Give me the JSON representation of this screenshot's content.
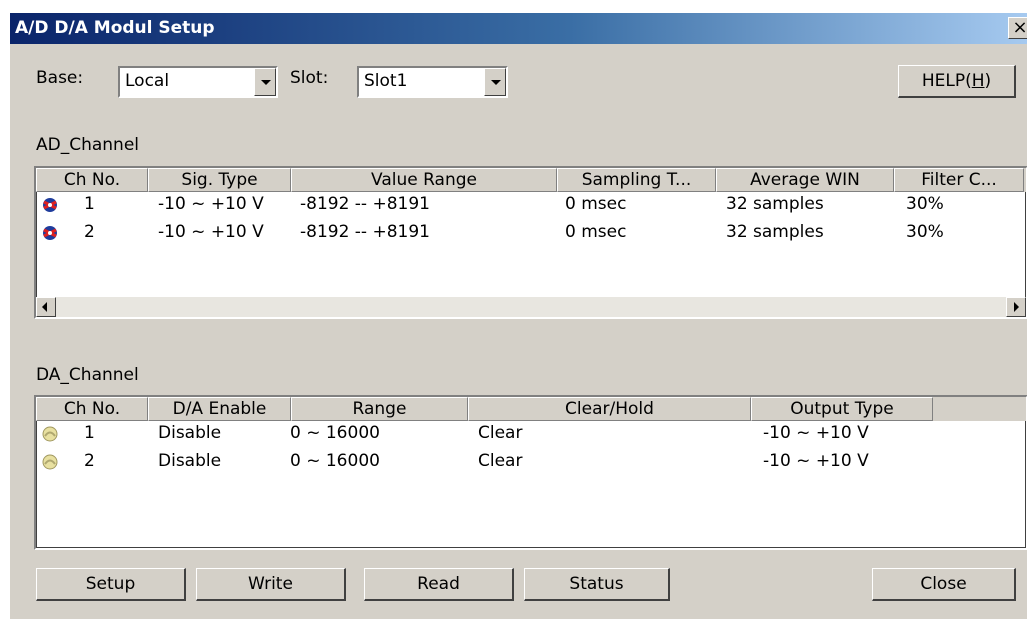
{
  "window": {
    "title": "A/D D/A Modul Setup",
    "close_glyph": "×"
  },
  "top": {
    "base_label": "Base:",
    "base_value": "Local",
    "slot_label": "Slot:",
    "slot_value": "Slot1",
    "help_label": "HELP(",
    "help_mnemonic": "H",
    "help_suffix": ")"
  },
  "ad": {
    "group_label": "AD_Channel",
    "columns": [
      "Ch No.",
      "Sig. Type",
      "Value Range",
      "Sampling T...",
      "Average WIN",
      "Filter C..."
    ],
    "rows": [
      {
        "icon": "ad-channel-icon",
        "ch": "1",
        "sig": "-10 ~ +10 V",
        "range": "-8192 -- +8191",
        "sampling": "0 msec",
        "average": "32 samples",
        "filter": "30%"
      },
      {
        "icon": "ad-channel-icon",
        "ch": "2",
        "sig": "-10 ~ +10 V",
        "range": "-8192 -- +8191",
        "sampling": "0 msec",
        "average": "32 samples",
        "filter": "30%"
      }
    ]
  },
  "da": {
    "group_label": "DA_Channel",
    "columns": [
      "Ch No.",
      "D/A Enable",
      "Range",
      "Clear/Hold",
      "Output Type"
    ],
    "rows": [
      {
        "icon": "da-channel-icon",
        "ch": "1",
        "enable": "Disable",
        "range": "0 ~ 16000",
        "clear": "Clear",
        "output": "-10 ~ +10 V"
      },
      {
        "icon": "da-channel-icon",
        "ch": "2",
        "enable": "Disable",
        "range": "0 ~ 16000",
        "clear": "Clear",
        "output": "-10 ~ +10 V"
      }
    ]
  },
  "buttons": {
    "setup": "Setup",
    "write": "Write",
    "read": "Read",
    "status": "Status",
    "close": "Close"
  },
  "colors": {
    "title_start": "#0a246a",
    "title_end": "#a6caf0",
    "face": "#d4d0c8"
  }
}
